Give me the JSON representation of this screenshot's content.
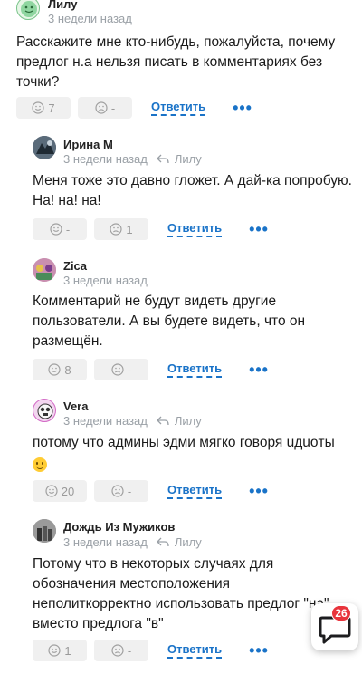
{
  "comments": [
    {
      "author": "Лилу",
      "time": "3 недели назад",
      "reply_to": "",
      "text_lines": [
        "Расскажите мне кто-нибудь, пожалуйста, почему",
        "предлог н.а нельзя писать в комментариях без",
        "точки?"
      ],
      "likes": "7",
      "dislikes": "-",
      "reply_label": "Ответить",
      "more_label": "•••"
    },
    {
      "author": "Ирина М",
      "time": "3 недели назад",
      "reply_to": "Лилу",
      "text_lines": [
        "Меня тоже это давно гложет. А дай-ка попробую.",
        "На! на! на!"
      ],
      "likes": "-",
      "dislikes": "1",
      "reply_label": "Ответить",
      "more_label": "•••"
    },
    {
      "author": "Zica",
      "time": "3 недели назад",
      "reply_to": "",
      "text_lines": [
        "Комментарий не будут видеть другие",
        "пользователи. А вы будете видеть, что он",
        "размещён."
      ],
      "likes": "8",
      "dislikes": "-",
      "reply_label": "Ответить",
      "more_label": "•••"
    },
    {
      "author": "Vera",
      "time": "3 недели назад",
      "reply_to": "Лилу",
      "text_lines": [
        "потому что админы эдми мягко говоря uдuoты"
      ],
      "likes": "20",
      "dislikes": "-",
      "reply_label": "Ответить",
      "more_label": "•••"
    },
    {
      "author": "Дождь Из Мужиков",
      "time": "3 недели назад",
      "reply_to": "Лилу",
      "text_lines": [
        "Потому что в некоторых случаях для",
        "обозначения местоположения",
        "неполиткорректно использовать предлог \"на\"",
        "вместо предлога \"в\""
      ],
      "likes": "1",
      "dislikes": "-",
      "reply_label": "Ответить",
      "more_label": "•••"
    }
  ],
  "chat_fab": {
    "badge_count": "26"
  },
  "colors": {
    "link": "#1a73c8",
    "muted": "#9aa0a6",
    "reaction_bg": "#f0f0f0",
    "badge": "#e8343c"
  }
}
